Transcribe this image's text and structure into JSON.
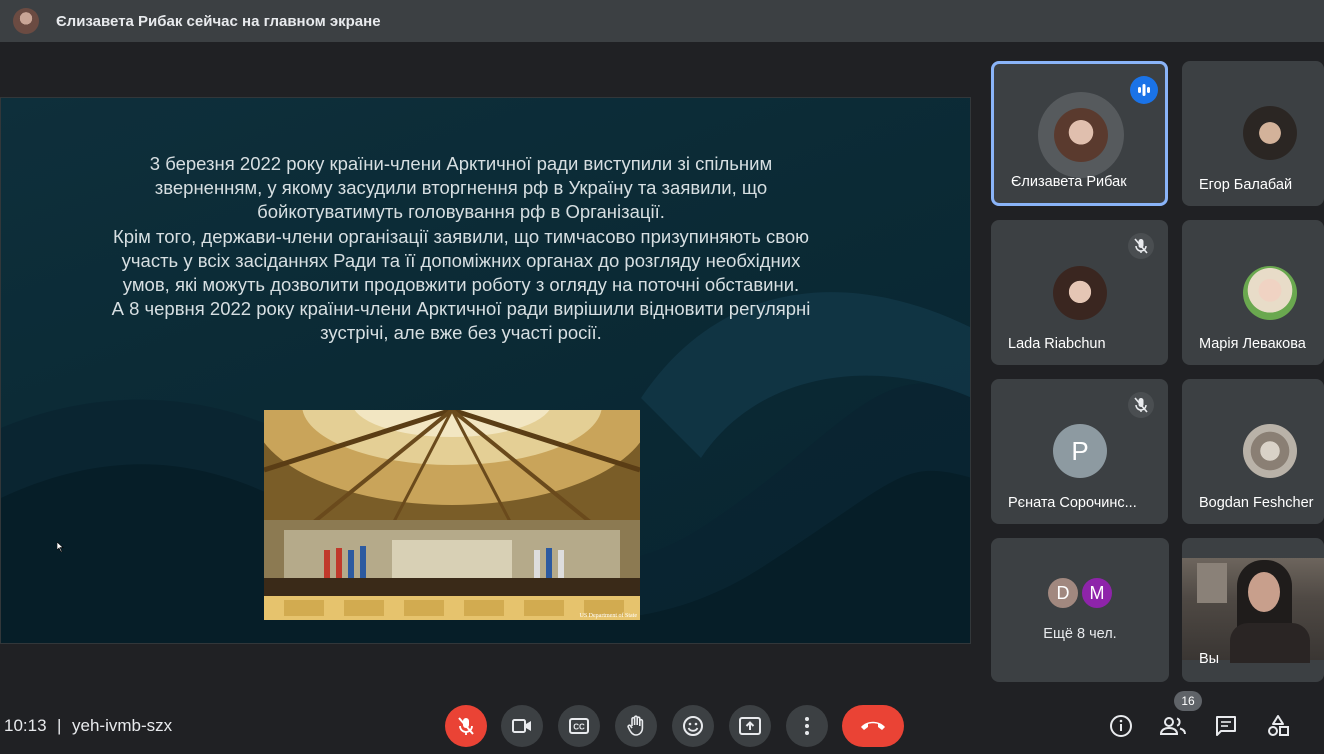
{
  "header": {
    "presenting_text": "Єлизавета Рибак сейчас на главном экране"
  },
  "slide": {
    "paragraphs": [
      "3 березня 2022 року країни-члени Арктичної ради  виступили зі спільним зверненням, у якому засудили вторгнення рф в Україну та заявили, що бойкотуватимуть головування рф в Організації.",
      "Крім того, держави-члени організації заявили, що тимчасово призупиняють свою участь у всіх засіданнях Ради та її допоміжних органах до розгляду необхідних умов, які можуть дозволити продовжити роботу з огляду на поточні обставини.",
      "А  8 червня 2022 року країни-члени Арктичної ради вирішили відновити регулярні зустрічі, але вже без участі росії."
    ],
    "photo_credit": "US Department of State"
  },
  "participants": [
    {
      "name": "Єлизавета Рибак",
      "speaking": true
    },
    {
      "name": "Егор Балабай"
    },
    {
      "name": "Lada Riabchun",
      "muted": true
    },
    {
      "name": "Марія Левакова"
    },
    {
      "name": "Рєната Сорочинс...",
      "muted": true,
      "initial": "P"
    },
    {
      "name": "Bogdan Feshcher"
    },
    {
      "name": "Ещё 8 чел.",
      "initials": [
        "D",
        "M"
      ]
    },
    {
      "name": "Вы"
    }
  ],
  "footer": {
    "time": "10:13",
    "separator": "|",
    "meeting_code": "yeh-ivmb-szx",
    "participant_count": "16"
  },
  "colors": {
    "accent": "#8ab4f8",
    "danger": "#ea4335",
    "tile_bg": "#3c4043",
    "page_bg": "#202124"
  }
}
